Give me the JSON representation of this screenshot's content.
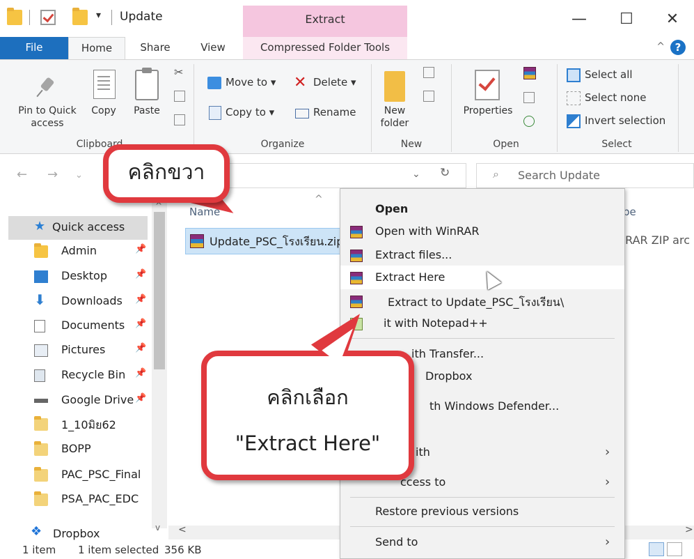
{
  "window": {
    "title": "Update",
    "contextual_tab_header": "Extract",
    "minimize": "—",
    "maximize": "☐",
    "close": "✕"
  },
  "quick_access_toolbar": {
    "dropdown": "▾"
  },
  "ribbon_tabs": [
    {
      "label": "File"
    },
    {
      "label": "Home"
    },
    {
      "label": "Share"
    },
    {
      "label": "View"
    },
    {
      "label": "Compressed Folder Tools"
    }
  ],
  "ribbon": {
    "clipboard": {
      "group_label": "Clipboard",
      "pin_label": "Pin to Quick access",
      "copy_label": "Copy",
      "paste_label": "Paste"
    },
    "organize": {
      "group_label": "Organize",
      "move_to": "Move to ▾",
      "delete": "Delete ▾",
      "copy_to": "Copy to ▾",
      "rename": "Rename"
    },
    "new": {
      "group_label": "New",
      "new_folder": "New folder"
    },
    "open": {
      "group_label": "Open",
      "properties": "Properties"
    },
    "select": {
      "group_label": "Select",
      "select_all": "Select all",
      "select_none": "Select none",
      "invert_selection": "Invert selection"
    }
  },
  "address_bar": {
    "search_placeholder": "Search Update"
  },
  "nav_pane": {
    "items": [
      {
        "label": "Quick access"
      },
      {
        "label": "Admin"
      },
      {
        "label": "Desktop"
      },
      {
        "label": "Downloads"
      },
      {
        "label": "Documents"
      },
      {
        "label": "Pictures"
      },
      {
        "label": "Recycle Bin"
      },
      {
        "label": "Google Drive"
      },
      {
        "label": "1_10มิย62"
      },
      {
        "label": "BOPP"
      },
      {
        "label": "PAC_PSC_Final"
      },
      {
        "label": "PSA_PAC_EDC"
      },
      {
        "label": "Dropbox"
      }
    ]
  },
  "file_list": {
    "column_name": "Name",
    "column_type": "pe",
    "files": [
      {
        "name": "Update_PSC_โรงเรียน.zip",
        "type": "nRAR ZIP arc"
      }
    ]
  },
  "context_menu": {
    "items": [
      {
        "label": "Open"
      },
      {
        "label": "Open with WinRAR"
      },
      {
        "label": "Extract files..."
      },
      {
        "label": "Extract Here"
      },
      {
        "label": "Extract to Update_PSC_โรงเรียน\\"
      },
      {
        "label": "it with Notepad++"
      },
      {
        "label": "ith Transfer..."
      },
      {
        "label": "Dropbox"
      },
      {
        "label": "th Windows Defender..."
      },
      {
        "label": "ith"
      },
      {
        "label": "ccess to"
      },
      {
        "label": "Restore previous versions"
      },
      {
        "label": "Send to"
      }
    ]
  },
  "status_bar": {
    "item_count": "1 item",
    "selection": "1 item selected",
    "size": "356 KB"
  },
  "callouts": {
    "right_click": "คลิกขวา",
    "choose": "คลิกเลือก",
    "extract_here_quote": "\"Extract Here\""
  },
  "colors": {
    "file_tab": "#1d6fbe",
    "contextual_tab": "#f5c6df",
    "callout_border": "#e0393e",
    "selection": "#cde4f7"
  }
}
